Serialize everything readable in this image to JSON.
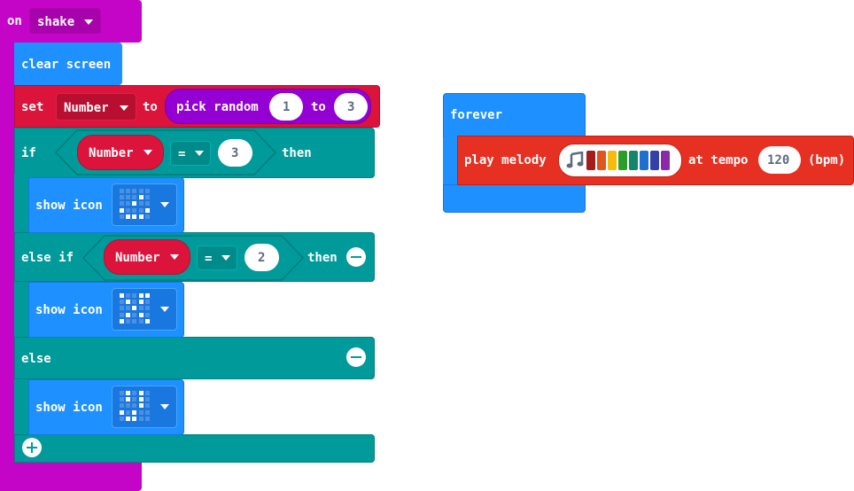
{
  "colors": {
    "input": "#c405c8",
    "basic": "#1e90ff",
    "variables": "#dc143c",
    "math": "#9400d3",
    "logic": "#009a9a",
    "music": "#e63022",
    "label": "#ffffff",
    "value_text": "#5b6b80"
  },
  "on_shake": {
    "keyword": "on",
    "gesture": "shake",
    "clear_screen": "clear screen",
    "set_block": {
      "set": "set",
      "variable": "Number",
      "to": "to",
      "pick_random": "pick random",
      "min": "1",
      "to2": "to",
      "max": "3"
    },
    "if_block": {
      "if": "if",
      "variable": "Number",
      "operator": "=",
      "value": "3",
      "then": "then"
    },
    "show_icon_1": {
      "label": "show icon",
      "icon_name": "confused-face-icon"
    },
    "else_if_block": {
      "else_if": "else if",
      "variable": "Number",
      "operator": "=",
      "value": "2",
      "then": "then"
    },
    "show_icon_2": {
      "label": "show icon",
      "icon_name": "surprised-face-icon"
    },
    "else": "else",
    "show_icon_3": {
      "label": "show icon",
      "icon_name": "happy-face-icon"
    }
  },
  "forever": {
    "label": "forever",
    "play_melody": {
      "label": "play melody",
      "at_tempo": "at tempo",
      "tempo": "120",
      "unit": "(bpm)",
      "melody_colors": [
        "#a31d1d",
        "#e0561f",
        "#f5bc0d",
        "#2b9d2b",
        "#13876b",
        "#1d6fd1",
        "#3240a8",
        "#8a2aa8"
      ]
    }
  }
}
